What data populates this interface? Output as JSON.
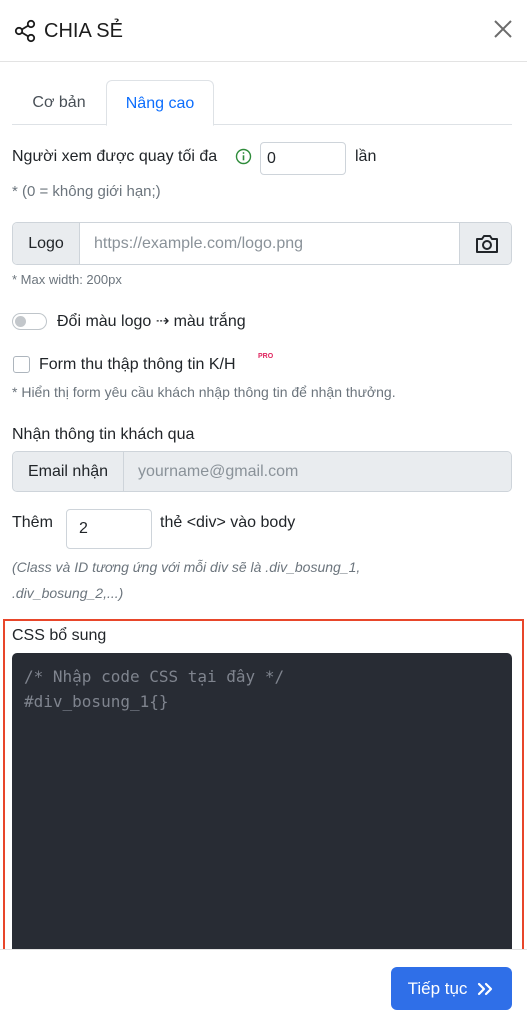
{
  "header": {
    "title": "CHIA SẺ",
    "share_icon": "share-icon",
    "close_icon": "close-icon"
  },
  "tabs": [
    {
      "label": "Cơ bản",
      "active": false
    },
    {
      "label": "Nâng cao",
      "active": true
    }
  ],
  "max_views": {
    "label": "Người xem được quay tối đa",
    "value": "0",
    "unit": "lần",
    "hint": "* (0 = không giới hạn;)"
  },
  "logo": {
    "addon": "Logo",
    "placeholder": "https://example.com/logo.png",
    "hint": "* Max width: 200px",
    "camera_icon": "camera-icon"
  },
  "logo_color": {
    "label": "Đổi màu logo ⇢ màu trắng",
    "enabled": false
  },
  "lead_form": {
    "label": "Form thu thập thông tin K/H",
    "badge": "PRO",
    "hint": "* Hiển thị form yêu cầu khách nhập thông tin để nhận thưởng.",
    "checked": false
  },
  "receive": {
    "label": "Nhận thông tin khách qua",
    "addon": "Email nhận",
    "placeholder": "yourname@gmail.com"
  },
  "extra_divs": {
    "prefix": "Thêm",
    "value": "2",
    "suffix": "thẻ <div> vào body",
    "hint_line1": "(Class và ID tương ứng với mỗi div sẽ là .div_bosung_1,",
    "hint_line2": ".div_bosung_2,...)"
  },
  "css": {
    "label": "CSS bổ sung",
    "code_line1": "/* Nhập code CSS tại đây */",
    "code_line2": "#div_bosung_1{}"
  },
  "footer": {
    "next_label": "Tiếp tục",
    "next_icon": "double-chevron-right-icon"
  },
  "colors": {
    "accent": "#2f6fe8",
    "highlight": "#e8462a",
    "editor_bg": "#282c34"
  }
}
